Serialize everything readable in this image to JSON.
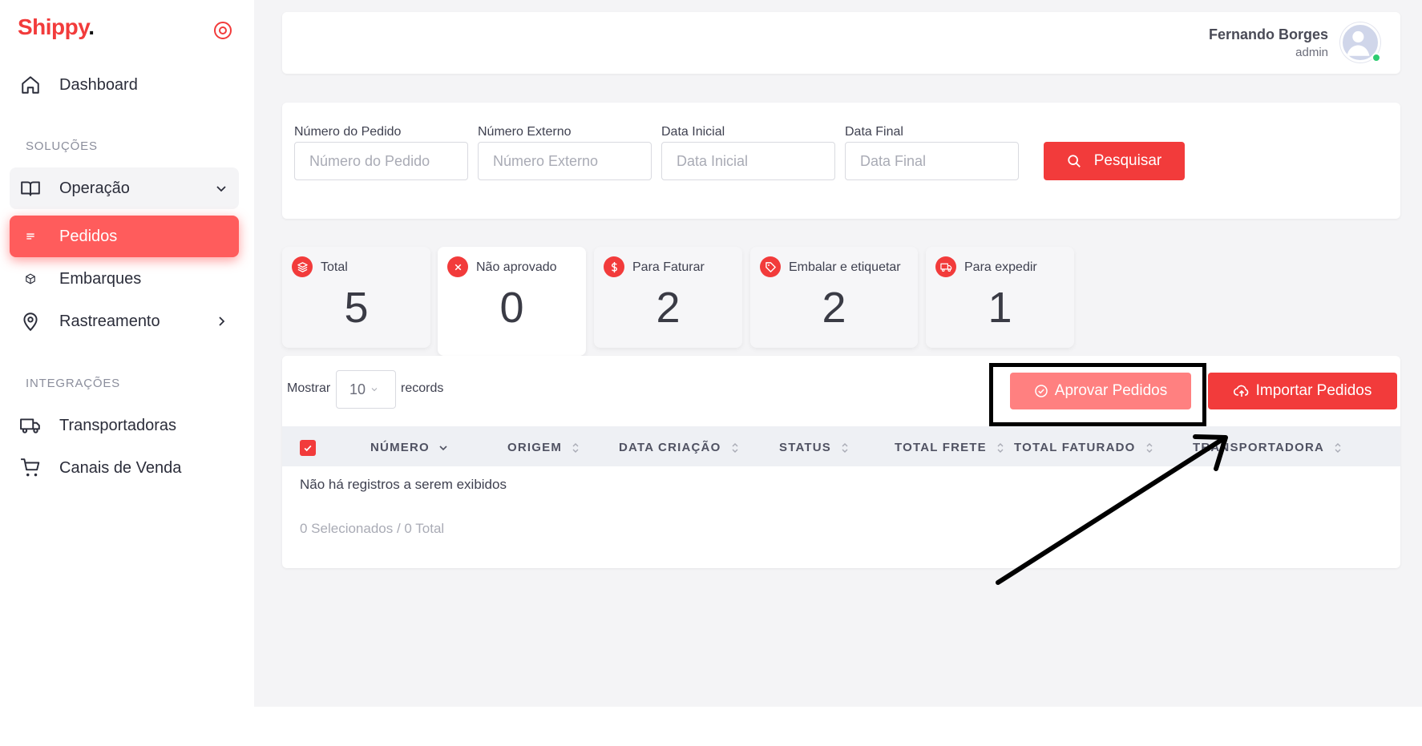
{
  "brand": {
    "name": "Shippy",
    "dot": ".",
    "accent": "#f23b3b"
  },
  "sidebar": {
    "dashboard": "Dashboard",
    "section_solutions": "SOLUÇÕES",
    "operacao": "Operação",
    "pedidos": "Pedidos",
    "embarques": "Embarques",
    "rastreamento": "Rastreamento",
    "section_integrations": "INTEGRAÇÕES",
    "transportadoras": "Transportadoras",
    "canais": "Canais de Venda"
  },
  "user": {
    "name": "Fernando Borges",
    "role": "admin"
  },
  "filters": {
    "numero_pedido_label": "Número do Pedido",
    "numero_pedido_placeholder": "Número do Pedido",
    "numero_externo_label": "Número Externo",
    "numero_externo_placeholder": "Número Externo",
    "data_inicial_label": "Data Inicial",
    "data_inicial_placeholder": "Data Inicial",
    "data_final_label": "Data Final",
    "data_final_placeholder": "Data Final",
    "search_button": "Pesquisar"
  },
  "stats": [
    {
      "label": "Total",
      "value": "5",
      "icon": "layers-icon"
    },
    {
      "label": "Não aprovado",
      "value": "0",
      "icon": "x-circle-icon"
    },
    {
      "label": "Para Faturar",
      "value": "2",
      "icon": "dollar-icon"
    },
    {
      "label": "Embalar e etiquetar",
      "value": "2",
      "icon": "tag-icon"
    },
    {
      "label": "Para expedir",
      "value": "1",
      "icon": "truck-icon"
    }
  ],
  "table": {
    "show_label": "Mostrar",
    "page_size": "10",
    "records_label": "records",
    "approve_button": "Aprovar Pedidos",
    "import_button": "Importar Pedidos",
    "columns": [
      "NÚMERO",
      "ORIGEM",
      "DATA CRIAÇÃO",
      "STATUS",
      "TOTAL FRETE",
      "TOTAL FATURADO",
      "TRANSPORTADORA"
    ],
    "empty_message": "Não há registros a serem exibidos",
    "selection_summary": "0 Selecionados / 0 Total"
  }
}
